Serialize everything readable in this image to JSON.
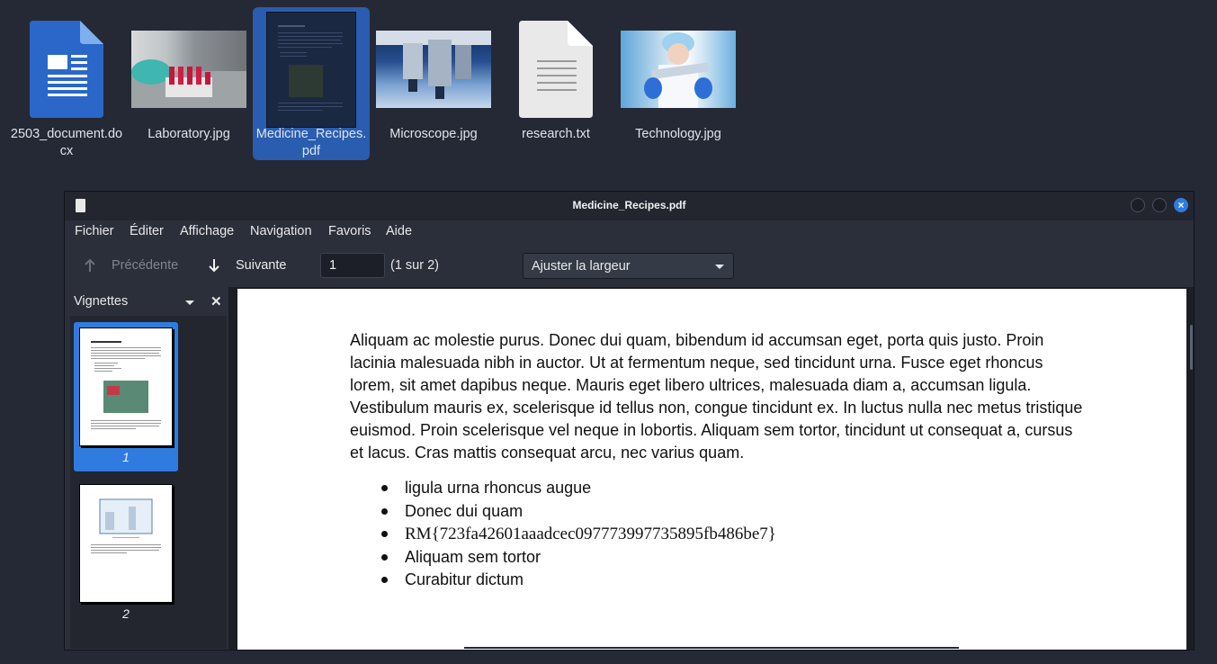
{
  "desktop": {
    "icons": [
      {
        "name": "2503_document.docx",
        "label": "2503_document.do cx"
      },
      {
        "name": "Laboratory.jpg",
        "label": "Laboratory.jpg"
      },
      {
        "name": "Medicine_Recipes.pdf",
        "label": "Medicine_Recipes. pdf"
      },
      {
        "name": "Microscope.jpg",
        "label": "Microscope.jpg"
      },
      {
        "name": "research.txt",
        "label": "research.txt"
      },
      {
        "name": "Technology.jpg",
        "label": "Technology.jpg"
      }
    ],
    "selected": "Medicine_Recipes.pdf"
  },
  "window": {
    "title": "Medicine_Recipes.pdf"
  },
  "menu": [
    "Fichier",
    "Éditer",
    "Affichage",
    "Navigation",
    "Favoris",
    "Aide"
  ],
  "toolbar": {
    "prev_label": "Précédente",
    "next_label": "Suivante",
    "page_value": "1",
    "page_count": "(1 sur 2)",
    "zoom_label": "Ajuster la largeur"
  },
  "sidebar": {
    "title": "Vignettes",
    "thumbnails": [
      {
        "number": "1",
        "active": true
      },
      {
        "number": "2",
        "active": false
      }
    ]
  },
  "document": {
    "paragraph": "Aliquam ac molestie purus. Donec dui quam, bibendum id accumsan eget,  porta quis justo. Proin lacinia malesuada nibh in auctor. Ut at  fermentum neque, sed tincidunt urna. Fusce eget rhoncus lorem, sit amet  dapibus neque. Mauris eget libero ultrices, malesuada diam a, accumsan  ligula. Vestibulum mauris ex, scelerisque id tellus non, congue  tincidunt ex. In luctus nulla nec metus tristique euismod. Proin  scelerisque vel neque in lobortis. Aliquam sem tortor, tincidunt ut  consequat a, cursus et lacus. Cras mattis consequat arcu, nec varius  quam.",
    "bullets": [
      "ligula urna rhoncus augue",
      "Donec dui quam",
      "RM{723fa42601aaadcec097773997735895fb486be7}",
      "Aliquam sem tortor",
      "Curabitur dictum"
    ]
  },
  "colors": {
    "desktop_bg": "#252935",
    "accent": "#2f7be0",
    "window_bg": "#2b2f3a"
  }
}
